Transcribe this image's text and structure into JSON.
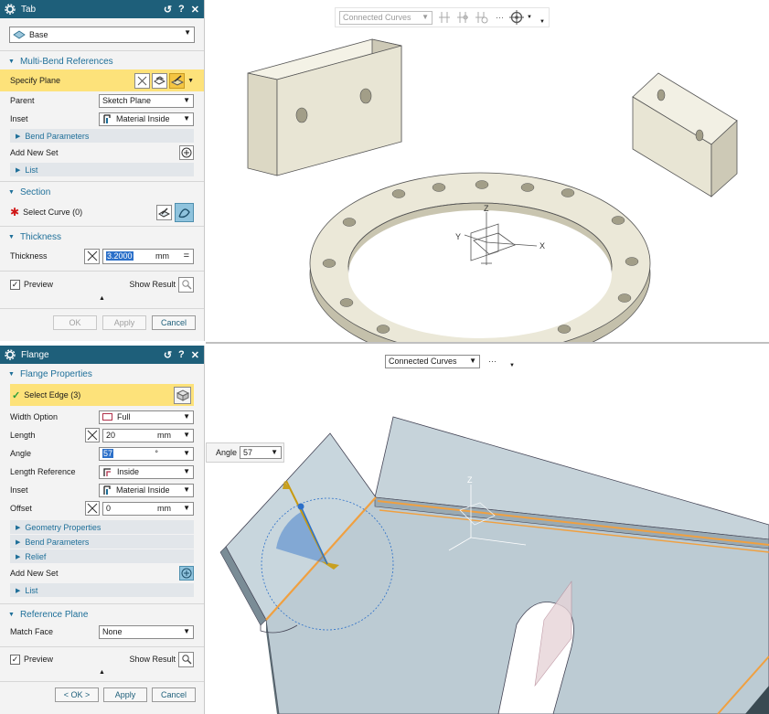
{
  "tab_dialog": {
    "title": "Tab",
    "reset_icon": "↺",
    "help_icon": "?",
    "close_icon": "✕",
    "type_value": "Base",
    "multi_bend_header": "Multi-Bend References",
    "specify_plane_label": "Specify Plane",
    "parent_label": "Parent",
    "parent_value": "Sketch Plane",
    "inset_label": "Inset",
    "inset_value": "Material Inside",
    "bend_parameters_label": "Bend Parameters",
    "add_new_set_label": "Add New Set",
    "list_label": "List",
    "section_header": "Section",
    "select_curve_label": "Select Curve (0)",
    "thickness_header": "Thickness",
    "thickness_label": "Thickness",
    "thickness_value": "3.2000",
    "thickness_unit": "mm",
    "preview_label": "Preview",
    "show_result_label": "Show Result",
    "ok_label": "OK",
    "apply_label": "Apply",
    "cancel_label": "Cancel"
  },
  "flange_dialog": {
    "title": "Flange",
    "reset_icon": "↺",
    "help_icon": "?",
    "close_icon": "✕",
    "flange_properties_header": "Flange Properties",
    "select_edge_label": "Select Edge (3)",
    "width_option_label": "Width Option",
    "width_option_value": "Full",
    "length_label": "Length",
    "length_value": "20",
    "length_unit": "mm",
    "angle_label": "Angle",
    "angle_value": "57",
    "angle_unit": "°",
    "length_reference_label": "Length Reference",
    "length_reference_value": "Inside",
    "inset_label": "Inset",
    "inset_value": "Material Inside",
    "offset_label": "Offset",
    "offset_value": "0",
    "offset_unit": "mm",
    "geometry_properties_label": "Geometry Properties",
    "bend_parameters_label": "Bend Parameters",
    "relief_label": "Relief",
    "add_new_set_label": "Add New Set",
    "list_label": "List",
    "reference_plane_header": "Reference Plane",
    "match_face_label": "Match Face",
    "match_face_value": "None",
    "preview_label": "Preview",
    "show_result_label": "Show Result",
    "ok_label": "< OK >",
    "apply_label": "Apply",
    "cancel_label": "Cancel"
  },
  "top_view": {
    "filter_value": "Connected Curves",
    "more_icon": "···",
    "axis_x": "X",
    "axis_y": "Y",
    "axis_z": "Z"
  },
  "bottom_view": {
    "filter_value": "Connected Curves",
    "more_icon": "···",
    "angle_label": "Angle",
    "angle_value": "57",
    "axis_z": "Z"
  },
  "colors": {
    "titlebar": "#1e5f7a",
    "section_text": "#1e6f99",
    "highlight": "#fde27a",
    "part_fill": "#e8e5d4",
    "sheet_fill": "#b8c8d0",
    "edge_highlight": "#f0a040"
  }
}
